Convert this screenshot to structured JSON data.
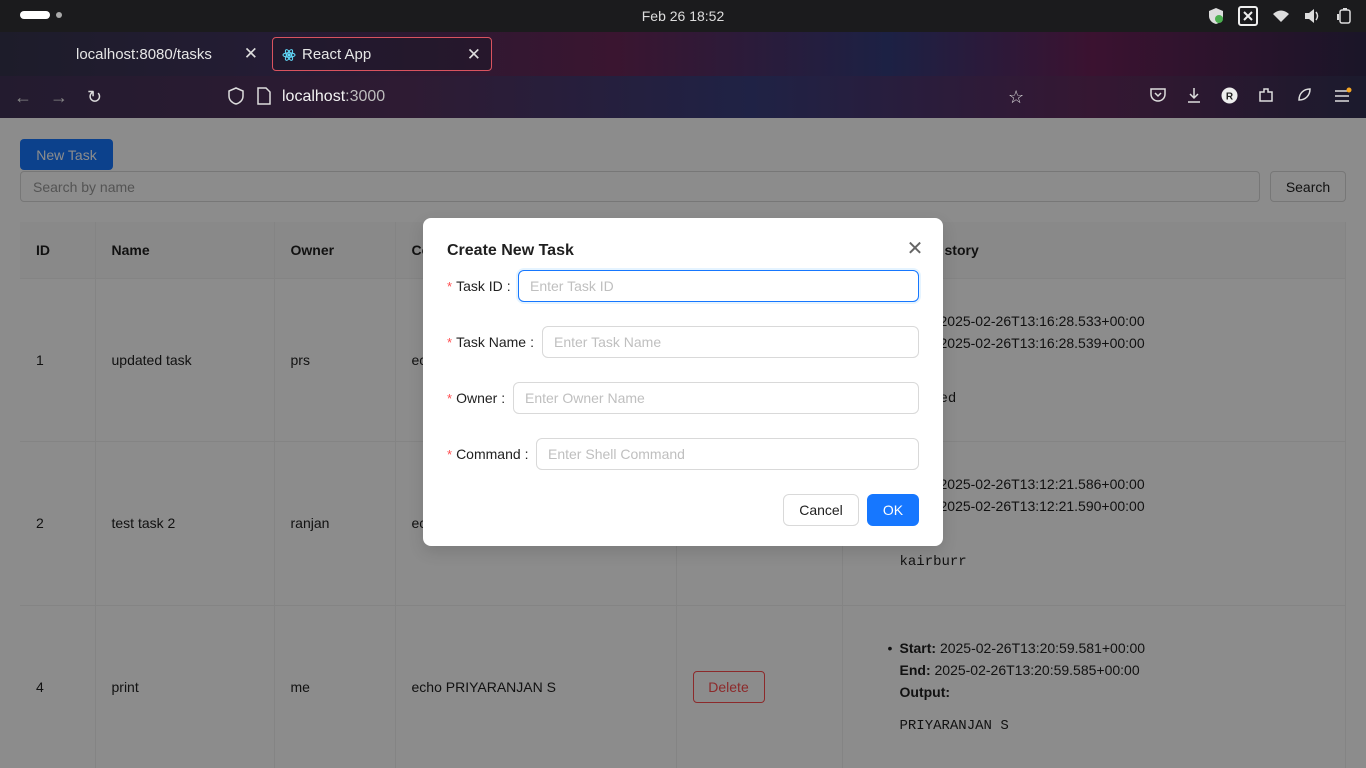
{
  "os": {
    "clock": "Feb 26  18:52"
  },
  "browser": {
    "tabs": [
      {
        "label": "localhost:8080/tasks"
      },
      {
        "label": "React App"
      }
    ],
    "url_host": "localhost",
    "url_port": ":3000"
  },
  "page": {
    "new_task_label": "New Task",
    "search_placeholder": "Search by name",
    "search_button": "Search"
  },
  "table": {
    "headers": [
      "ID",
      "Name",
      "Owner",
      "Co",
      "",
      "story"
    ],
    "rows": [
      {
        "id": "1",
        "name": "updated task",
        "owner": "prs",
        "command": "ec",
        "start": "2025-02-26T13:16:28.533+00:00",
        "end": "2025-02-26T13:16:28.539+00:00",
        "output_label": ":",
        "output": "ed"
      },
      {
        "id": "2",
        "name": "test task 2",
        "owner": "ranjan",
        "command": "ec",
        "start": "2025-02-26T13:12:21.586+00:00",
        "end": "2025-02-26T13:12:21.590+00:00",
        "output_label": ":",
        "output": "kairburr"
      },
      {
        "id": "4",
        "name": "print",
        "owner": "me",
        "command": "echo PRIYARANJAN S",
        "delete": "Delete",
        "start_label": "Start:",
        "start": "2025-02-26T13:20:59.581+00:00",
        "end_label": "End:",
        "end": "2025-02-26T13:20:59.585+00:00",
        "output_label": "Output:",
        "output": "PRIYARANJAN S"
      }
    ]
  },
  "modal": {
    "title": "Create New Task",
    "fields": [
      {
        "label": "Task ID",
        "placeholder": "Enter Task ID"
      },
      {
        "label": "Task Name",
        "placeholder": "Enter Task Name"
      },
      {
        "label": "Owner",
        "placeholder": "Enter Owner Name"
      },
      {
        "label": "Command",
        "placeholder": "Enter Shell Command"
      }
    ],
    "cancel_label": "Cancel",
    "ok_label": "OK"
  },
  "colors": {
    "primary": "#1677ff",
    "danger": "#ff4d4f"
  }
}
